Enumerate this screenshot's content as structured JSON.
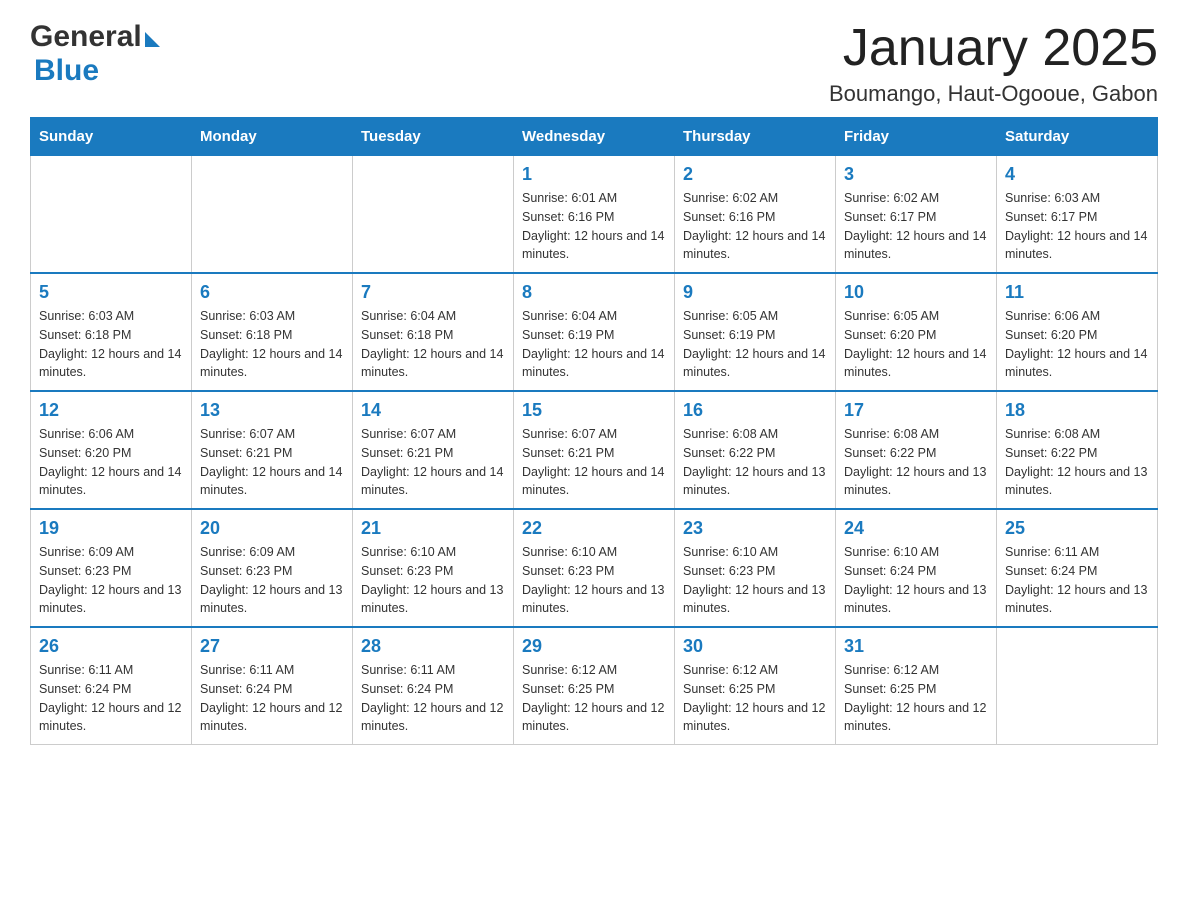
{
  "logo": {
    "general": "General",
    "blue": "Blue"
  },
  "header": {
    "title": "January 2025",
    "subtitle": "Boumango, Haut-Ogooue, Gabon"
  },
  "weekdays": [
    "Sunday",
    "Monday",
    "Tuesday",
    "Wednesday",
    "Thursday",
    "Friday",
    "Saturday"
  ],
  "weeks": [
    [
      {
        "day": "",
        "sunrise": "",
        "sunset": "",
        "daylight": ""
      },
      {
        "day": "",
        "sunrise": "",
        "sunset": "",
        "daylight": ""
      },
      {
        "day": "",
        "sunrise": "",
        "sunset": "",
        "daylight": ""
      },
      {
        "day": "1",
        "sunrise": "Sunrise: 6:01 AM",
        "sunset": "Sunset: 6:16 PM",
        "daylight": "Daylight: 12 hours and 14 minutes."
      },
      {
        "day": "2",
        "sunrise": "Sunrise: 6:02 AM",
        "sunset": "Sunset: 6:16 PM",
        "daylight": "Daylight: 12 hours and 14 minutes."
      },
      {
        "day": "3",
        "sunrise": "Sunrise: 6:02 AM",
        "sunset": "Sunset: 6:17 PM",
        "daylight": "Daylight: 12 hours and 14 minutes."
      },
      {
        "day": "4",
        "sunrise": "Sunrise: 6:03 AM",
        "sunset": "Sunset: 6:17 PM",
        "daylight": "Daylight: 12 hours and 14 minutes."
      }
    ],
    [
      {
        "day": "5",
        "sunrise": "Sunrise: 6:03 AM",
        "sunset": "Sunset: 6:18 PM",
        "daylight": "Daylight: 12 hours and 14 minutes."
      },
      {
        "day": "6",
        "sunrise": "Sunrise: 6:03 AM",
        "sunset": "Sunset: 6:18 PM",
        "daylight": "Daylight: 12 hours and 14 minutes."
      },
      {
        "day": "7",
        "sunrise": "Sunrise: 6:04 AM",
        "sunset": "Sunset: 6:18 PM",
        "daylight": "Daylight: 12 hours and 14 minutes."
      },
      {
        "day": "8",
        "sunrise": "Sunrise: 6:04 AM",
        "sunset": "Sunset: 6:19 PM",
        "daylight": "Daylight: 12 hours and 14 minutes."
      },
      {
        "day": "9",
        "sunrise": "Sunrise: 6:05 AM",
        "sunset": "Sunset: 6:19 PM",
        "daylight": "Daylight: 12 hours and 14 minutes."
      },
      {
        "day": "10",
        "sunrise": "Sunrise: 6:05 AM",
        "sunset": "Sunset: 6:20 PM",
        "daylight": "Daylight: 12 hours and 14 minutes."
      },
      {
        "day": "11",
        "sunrise": "Sunrise: 6:06 AM",
        "sunset": "Sunset: 6:20 PM",
        "daylight": "Daylight: 12 hours and 14 minutes."
      }
    ],
    [
      {
        "day": "12",
        "sunrise": "Sunrise: 6:06 AM",
        "sunset": "Sunset: 6:20 PM",
        "daylight": "Daylight: 12 hours and 14 minutes."
      },
      {
        "day": "13",
        "sunrise": "Sunrise: 6:07 AM",
        "sunset": "Sunset: 6:21 PM",
        "daylight": "Daylight: 12 hours and 14 minutes."
      },
      {
        "day": "14",
        "sunrise": "Sunrise: 6:07 AM",
        "sunset": "Sunset: 6:21 PM",
        "daylight": "Daylight: 12 hours and 14 minutes."
      },
      {
        "day": "15",
        "sunrise": "Sunrise: 6:07 AM",
        "sunset": "Sunset: 6:21 PM",
        "daylight": "Daylight: 12 hours and 14 minutes."
      },
      {
        "day": "16",
        "sunrise": "Sunrise: 6:08 AM",
        "sunset": "Sunset: 6:22 PM",
        "daylight": "Daylight: 12 hours and 13 minutes."
      },
      {
        "day": "17",
        "sunrise": "Sunrise: 6:08 AM",
        "sunset": "Sunset: 6:22 PM",
        "daylight": "Daylight: 12 hours and 13 minutes."
      },
      {
        "day": "18",
        "sunrise": "Sunrise: 6:08 AM",
        "sunset": "Sunset: 6:22 PM",
        "daylight": "Daylight: 12 hours and 13 minutes."
      }
    ],
    [
      {
        "day": "19",
        "sunrise": "Sunrise: 6:09 AM",
        "sunset": "Sunset: 6:23 PM",
        "daylight": "Daylight: 12 hours and 13 minutes."
      },
      {
        "day": "20",
        "sunrise": "Sunrise: 6:09 AM",
        "sunset": "Sunset: 6:23 PM",
        "daylight": "Daylight: 12 hours and 13 minutes."
      },
      {
        "day": "21",
        "sunrise": "Sunrise: 6:10 AM",
        "sunset": "Sunset: 6:23 PM",
        "daylight": "Daylight: 12 hours and 13 minutes."
      },
      {
        "day": "22",
        "sunrise": "Sunrise: 6:10 AM",
        "sunset": "Sunset: 6:23 PM",
        "daylight": "Daylight: 12 hours and 13 minutes."
      },
      {
        "day": "23",
        "sunrise": "Sunrise: 6:10 AM",
        "sunset": "Sunset: 6:23 PM",
        "daylight": "Daylight: 12 hours and 13 minutes."
      },
      {
        "day": "24",
        "sunrise": "Sunrise: 6:10 AM",
        "sunset": "Sunset: 6:24 PM",
        "daylight": "Daylight: 12 hours and 13 minutes."
      },
      {
        "day": "25",
        "sunrise": "Sunrise: 6:11 AM",
        "sunset": "Sunset: 6:24 PM",
        "daylight": "Daylight: 12 hours and 13 minutes."
      }
    ],
    [
      {
        "day": "26",
        "sunrise": "Sunrise: 6:11 AM",
        "sunset": "Sunset: 6:24 PM",
        "daylight": "Daylight: 12 hours and 12 minutes."
      },
      {
        "day": "27",
        "sunrise": "Sunrise: 6:11 AM",
        "sunset": "Sunset: 6:24 PM",
        "daylight": "Daylight: 12 hours and 12 minutes."
      },
      {
        "day": "28",
        "sunrise": "Sunrise: 6:11 AM",
        "sunset": "Sunset: 6:24 PM",
        "daylight": "Daylight: 12 hours and 12 minutes."
      },
      {
        "day": "29",
        "sunrise": "Sunrise: 6:12 AM",
        "sunset": "Sunset: 6:25 PM",
        "daylight": "Daylight: 12 hours and 12 minutes."
      },
      {
        "day": "30",
        "sunrise": "Sunrise: 6:12 AM",
        "sunset": "Sunset: 6:25 PM",
        "daylight": "Daylight: 12 hours and 12 minutes."
      },
      {
        "day": "31",
        "sunrise": "Sunrise: 6:12 AM",
        "sunset": "Sunset: 6:25 PM",
        "daylight": "Daylight: 12 hours and 12 minutes."
      },
      {
        "day": "",
        "sunrise": "",
        "sunset": "",
        "daylight": ""
      }
    ]
  ]
}
